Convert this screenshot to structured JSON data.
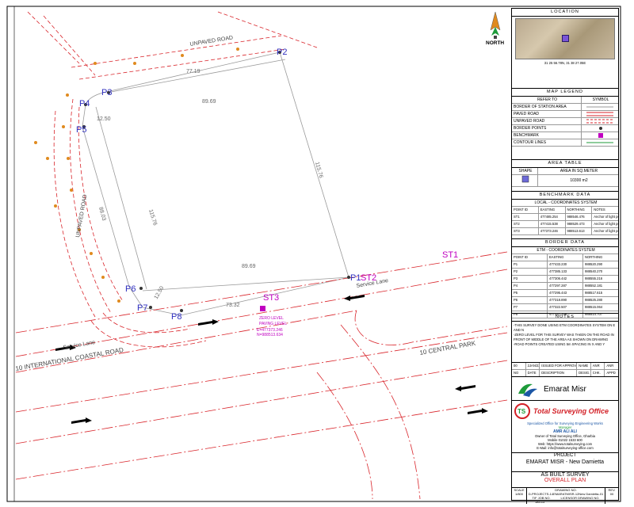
{
  "north_label": "NORTH",
  "points": {
    "p1": "P1",
    "p2": "P2",
    "p3": "P3",
    "p4": "P4",
    "p5": "P5",
    "p6": "P6",
    "p7": "P7",
    "p8": "P8",
    "st1": "ST1",
    "st2": "ST2",
    "st3": "ST3"
  },
  "dimensions": {
    "top": "77.19",
    "inner_top": "89.69",
    "right": "115.76",
    "left": "115.76",
    "bottom_inner": "89.69",
    "bottom": "73.32",
    "p4p5": "12.50",
    "p6p7": "12.50",
    "left_outer": "88.03"
  },
  "roads": {
    "unpaved_top": "UNPAVED ROAD",
    "unpaved_left": "UNPAVED ROAD",
    "service_lane_left": "Service Lane",
    "service_lane_right": "Service Lane",
    "coastal": "10 INTERNATIONAL COASTAL ROAD",
    "central": "10 CENTRAL PARK"
  },
  "zero_level": {
    "line1": "ZERO LEVEL",
    "line2": "PAVING LEVEL",
    "e": "E=477373.246",
    "n": "N=988513.634"
  },
  "title_block": {
    "location": {
      "title": "LOCATION",
      "coords": "31 25 56.78N, 31 38 27.05E"
    },
    "legend": {
      "title": "MAP LEGEND",
      "col_refer": "REFER TO",
      "col_symbol": "SYMBOL",
      "items": [
        "BORDER OF STATION AREA",
        "PAVED ROAD",
        "UNPAVED ROAD",
        "BORDER POINTS",
        "BENCHMARK",
        "CONTOUR LINES"
      ]
    },
    "area": {
      "title": "AREA TABLE",
      "col_shape": "SHAPE",
      "col_area": "AREA IN SQ.METER",
      "value": "10300 m2"
    },
    "benchmark": {
      "title": "BENCHMARK DATA",
      "subtitle": "LOCAL - COORDINATES SYSTEM",
      "headers": [
        "POINT ID",
        "EASTING",
        "NORTHING",
        "NOTES"
      ],
      "rows": [
        [
          "ST1",
          "477485.254",
          "988546.476",
          "Anchor of light pole"
        ],
        [
          "ST2",
          "477415.538",
          "988529.473",
          "Anchor of light pole"
        ],
        [
          "ST3",
          "477373.246",
          "988513.613",
          "Anchor of light pole"
        ]
      ]
    },
    "border": {
      "title": "BORDER DATA",
      "subtitle": "ETM - COORDINATES SYSTEM",
      "headers": [
        "POINT ID",
        "EASTING",
        "NORTHING"
      ],
      "rows": [
        [
          "P1",
          "477433.230",
          "988520.290"
        ],
        [
          "P2",
          "477385.133",
          "988540.270"
        ],
        [
          "P3",
          "477306.442",
          "988555.216"
        ],
        [
          "P4",
          "477297.287",
          "988552.181"
        ],
        [
          "P5",
          "477295.443",
          "988517.615"
        ],
        [
          "P6",
          "477318.890",
          "988525.280"
        ],
        [
          "P7",
          "477322.507",
          "988515.064"
        ],
        [
          "P8",
          "477327.708",
          "988514.707"
        ]
      ]
    },
    "notes": {
      "title": "NOTES",
      "lines": [
        "-THIS SURVEY DONE USING ETM COORDINATES SYSTEM ON E AND N",
        "-ZERO LEVEL FOR THIS SURVEY WAS TAKEN ON THE ROAD IN",
        "FRONT OF MIDDLE OF THE AREA AS SHOWN ON DRAWING",
        "-ROAD POINTS CREATED USING 5m SPACING IN X AND Y"
      ]
    },
    "revision": {
      "row": [
        "00",
        "2JAN/22",
        "ISSUED FOR APPROVAL",
        "NAME",
        "ANR",
        "ANR"
      ],
      "header": [
        "NO",
        "DATE",
        "DESCRIPTION",
        "DESIG.",
        "CHK.",
        "APPD"
      ]
    },
    "client": "Emarat Misr",
    "company": {
      "name": "Total Surveying Office",
      "tagline": "Specialized Office for Surveying Engineering Works",
      "manager_label": "Manager",
      "manager": "AMR ALI ALI",
      "address": "Owner of Total Surveying Office, Gharbia",
      "mobile": "Mobile 01022 1533 600",
      "web": "Web: https://www.totalsurveying.com",
      "email": "E-Mail: info@totalsurveying-office.com"
    },
    "project_label": "PROJECT",
    "project": "EMARAT MISR - New Damietta",
    "drawing_title1": "AS BUILT SURVEY",
    "drawing_title2": "OVERALL PLAN",
    "footer": {
      "scale_label": "SCALE",
      "scale": "1/800",
      "drawing_no_label": "DRAWING NO.",
      "drawing_no": "D-PROJECTS-14EMARATMISR-12New Damietta-01",
      "rev_label": "REV.",
      "rev": "00",
      "tif_label": "TIF JOB NO.",
      "tif": "184.15",
      "licensor_label": "LICENSOR DRAWING NO."
    }
  },
  "colors": {
    "paved_road": "#d9252b",
    "unpaved_road": "#d9252b",
    "border_line": "#9a9a9a",
    "point_label": "#2f2fbf",
    "benchmark": "#c000c0",
    "title_text": "#222222",
    "brand_green": "#1e9b3a",
    "brand_red": "#d32027",
    "brand_blue": "#1b56a5"
  }
}
